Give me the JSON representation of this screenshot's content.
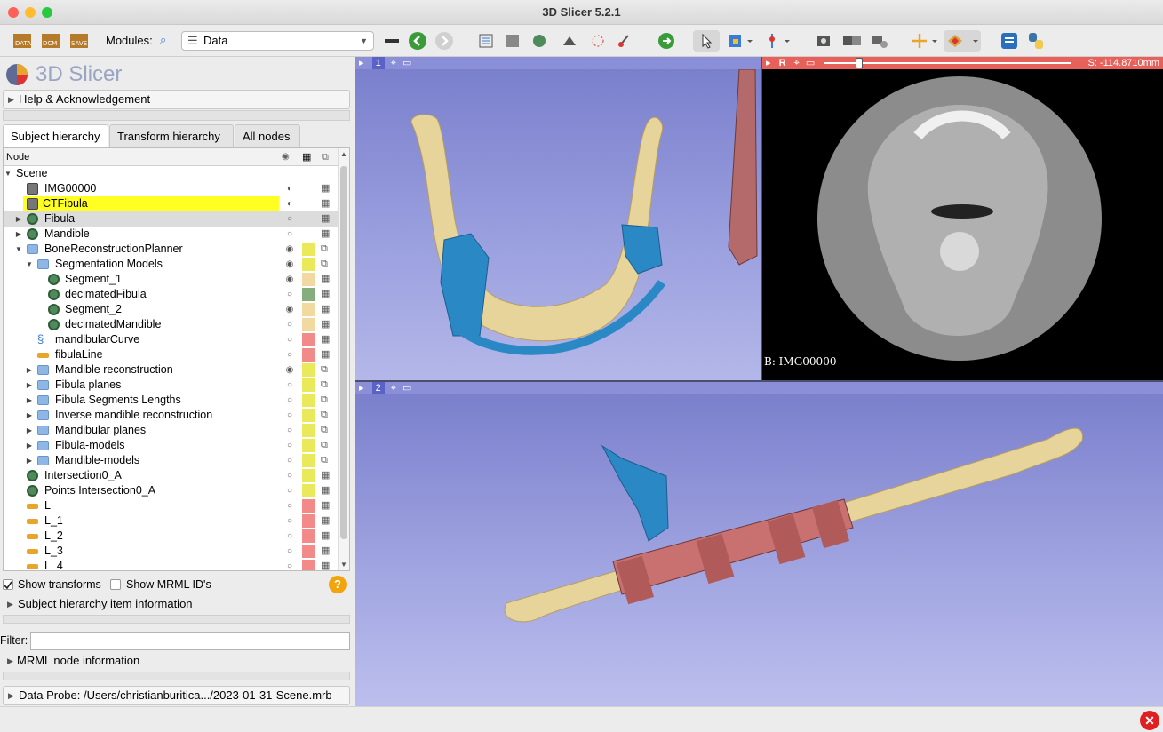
{
  "window": {
    "title": "3D Slicer 5.2.1"
  },
  "toolbar": {
    "modules_label": "Modules:",
    "module_selected": "Data"
  },
  "logo": {
    "text": "3D Slicer"
  },
  "help_panel": {
    "label": "Help & Acknowledgement"
  },
  "tabs": [
    "Subject hierarchy",
    "Transform hierarchy",
    "All nodes"
  ],
  "tree": {
    "header": "Node",
    "rows": [
      {
        "label": "Scene"
      },
      {
        "label": "IMG00000"
      },
      {
        "label": "CTFibula"
      },
      {
        "label": "Fibula"
      },
      {
        "label": "Mandible"
      },
      {
        "label": "BoneReconstructionPlanner"
      },
      {
        "label": "Segmentation Models"
      },
      {
        "label": "Segment_1"
      },
      {
        "label": "decimatedFibula"
      },
      {
        "label": "Segment_2"
      },
      {
        "label": "decimatedMandible"
      },
      {
        "label": "mandibularCurve"
      },
      {
        "label": "fibulaLine"
      },
      {
        "label": "Mandible reconstruction"
      },
      {
        "label": "Fibula planes"
      },
      {
        "label": "Fibula Segments Lengths"
      },
      {
        "label": "Inverse mandible reconstruction"
      },
      {
        "label": "Mandibular planes"
      },
      {
        "label": "Fibula-models"
      },
      {
        "label": "Mandible-models"
      },
      {
        "label": "Intersection0_A"
      },
      {
        "label": "Points Intersection0_A"
      },
      {
        "label": "L"
      },
      {
        "label": "L_1"
      },
      {
        "label": "L_2"
      },
      {
        "label": "L_3"
      },
      {
        "label": "L_4"
      }
    ]
  },
  "options": {
    "show_transforms": "Show transforms",
    "show_mrml_ids": "Show MRML ID's"
  },
  "sh_info": {
    "label": "Subject hierarchy item information"
  },
  "filter": {
    "label": "Filter:",
    "value": ""
  },
  "mrml_info": {
    "label": "MRML node information"
  },
  "data_probe": {
    "label": "Data Probe: /Users/christianburitica.../2023-01-31-Scene.mrb"
  },
  "view1": {
    "label": "1"
  },
  "view2": {
    "label": "2"
  },
  "slice_red": {
    "label": "R",
    "offset": "S: -114.8710mm",
    "background": "B: IMG00000",
    "slider_fraction": 0.13
  },
  "colors": {
    "slice_bar": "#e8605a",
    "view_bar": "#8a8fd8",
    "bone": "#e7d49a",
    "guide": "#2a88c5",
    "fibula_guide": "#c97070"
  }
}
